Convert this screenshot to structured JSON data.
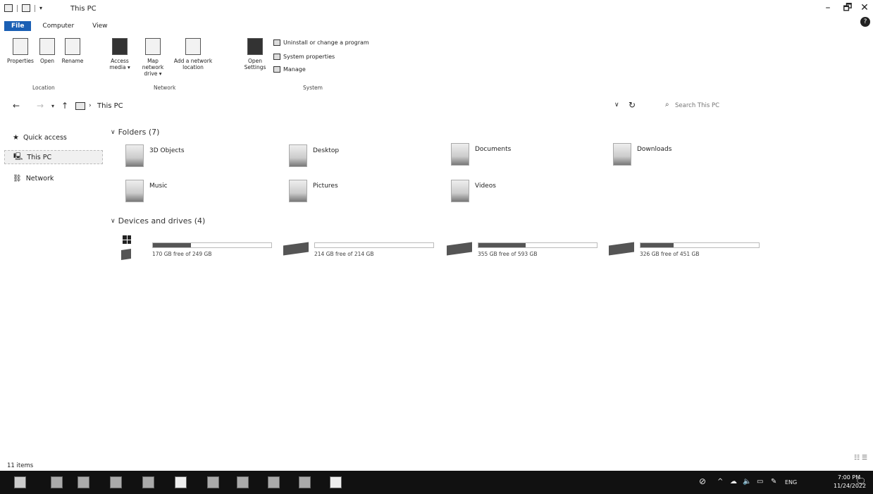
{
  "window": {
    "title": "This PC",
    "controls": {
      "minimize": "–",
      "maximize": "🗗",
      "close": "✕"
    }
  },
  "ribbon": {
    "tabs": [
      "File",
      "Computer",
      "View"
    ],
    "location_group": {
      "label": "Location",
      "buttons": [
        "Properties",
        "Open",
        "Rename"
      ]
    },
    "network_group": {
      "label": "Network",
      "buttons": [
        "Access media ▾",
        "Map network drive ▾",
        "Add a network location"
      ]
    },
    "system_group": {
      "label": "System",
      "open_settings": "Open Settings",
      "items": [
        "Uninstall or change a program",
        "System properties",
        "Manage"
      ]
    }
  },
  "navbar": {
    "back": "←",
    "forward": "→",
    "recent": "▾",
    "up": "↑",
    "separator": "›",
    "address": "This PC",
    "dropdown": "∨",
    "refresh": "↻",
    "search_icon": "⌕",
    "search_placeholder": "Search This PC"
  },
  "sidebar": {
    "items": [
      {
        "label": "Quick access",
        "icon": "star-icon",
        "glyph": "★"
      },
      {
        "label": "This PC",
        "icon": "computer-icon",
        "glyph": "🖳"
      },
      {
        "label": "Network",
        "icon": "network-icon",
        "glyph": "⛓"
      }
    ]
  },
  "folders": {
    "header": "Folders (7)",
    "items": [
      {
        "label": "3D Objects"
      },
      {
        "label": "Desktop"
      },
      {
        "label": "Documents"
      },
      {
        "label": "Downloads"
      },
      {
        "label": "Music"
      },
      {
        "label": "Pictures"
      },
      {
        "label": "Videos"
      }
    ]
  },
  "drives": {
    "header": "Devices and drives (4)",
    "items": [
      {
        "label": "",
        "free": "170 GB free of 249 GB",
        "used_fraction": 0.32,
        "windows": true
      },
      {
        "label": "",
        "free": "214 GB free of 214 GB",
        "used_fraction": 0.0,
        "windows": false
      },
      {
        "label": "",
        "free": "355 GB free of 593 GB",
        "used_fraction": 0.4,
        "windows": false
      },
      {
        "label": "",
        "free": "326 GB free of 451 GB",
        "used_fraction": 0.28,
        "windows": false
      }
    ]
  },
  "status": {
    "count": "11 items",
    "views": "☷ ☰"
  },
  "taskbar": {
    "tray": {
      "chevron": "^",
      "lang": "ENG",
      "time": "7:00 PM",
      "date": "11/24/2022",
      "notifications": "🗨"
    }
  }
}
